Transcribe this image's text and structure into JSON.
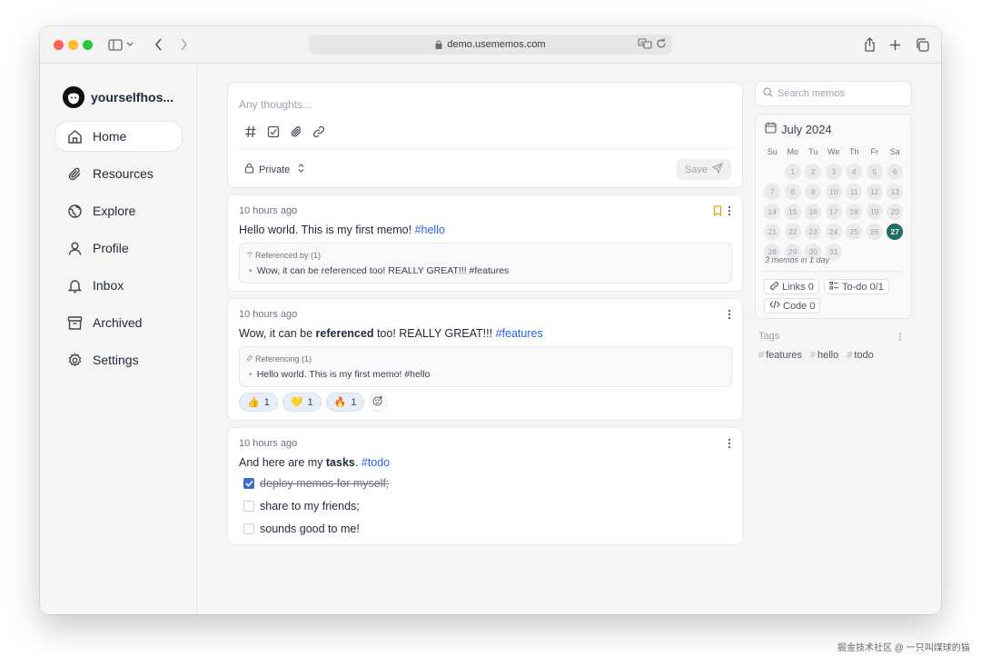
{
  "browser": {
    "url": "demo.usememos.com"
  },
  "sidebar": {
    "user_name": "yourselfhos...",
    "items": [
      {
        "label": "Home",
        "icon": "home-icon",
        "active": true
      },
      {
        "label": "Resources",
        "icon": "paperclip-icon"
      },
      {
        "label": "Explore",
        "icon": "globe-icon"
      },
      {
        "label": "Profile",
        "icon": "user-icon"
      },
      {
        "label": "Inbox",
        "icon": "bell-icon"
      },
      {
        "label": "Archived",
        "icon": "archive-icon"
      },
      {
        "label": "Settings",
        "icon": "gear-icon"
      }
    ]
  },
  "editor": {
    "placeholder": "Any thoughts...",
    "visibility": "Private",
    "save_label": "Save"
  },
  "memos": [
    {
      "time": "10 hours ago",
      "text": "Hello world. This is my first memo! ",
      "tag": "#hello",
      "ref_title": "Referenced by (1)",
      "ref_item": "Wow, it can be referenced too! REALLY GREAT!!! #features"
    },
    {
      "time": "10 hours ago",
      "text_a": "Wow, it can be ",
      "text_bold": "referenced",
      "text_b": " too! REALLY GREAT!!! ",
      "tag": "#features",
      "ref_title": "Referencing (1)",
      "ref_item": "Hello world. This is my first memo! #hello",
      "reactions": [
        {
          "emoji": "👍",
          "count": "1"
        },
        {
          "emoji": "💛",
          "count": "1"
        },
        {
          "emoji": "🔥",
          "count": "1"
        }
      ]
    },
    {
      "time": "10 hours ago",
      "text_a": "And here are my ",
      "text_bold": "tasks",
      "text_b": ". ",
      "tag": "#todo",
      "tasks": [
        {
          "label": "deploy memos for myself;",
          "done": true
        },
        {
          "label": "share to my friends;",
          "done": false
        },
        {
          "label": "sounds good to me!",
          "done": false
        }
      ]
    }
  ],
  "search": {
    "placeholder": "Search memos"
  },
  "calendar": {
    "month": "July 2024",
    "weekdays": [
      "Su",
      "Mo",
      "Tu",
      "We",
      "Th",
      "Fr",
      "Sa"
    ],
    "weeks": [
      [
        "",
        "1",
        "2",
        "3",
        "4",
        "5",
        "6"
      ],
      [
        "7",
        "8",
        "9",
        "10",
        "11",
        "12",
        "13"
      ],
      [
        "14",
        "15",
        "16",
        "17",
        "18",
        "19",
        "20"
      ],
      [
        "21",
        "22",
        "23",
        "24",
        "25",
        "26",
        "27"
      ],
      [
        "28",
        "29",
        "30",
        "31",
        "",
        "",
        ""
      ]
    ],
    "today": "27",
    "summary": "3 memos in 1 day"
  },
  "stats": {
    "links": "Links 0",
    "todo": "To-do 0/1",
    "code": "Code 0"
  },
  "tags": {
    "title": "Tags",
    "items": [
      "features",
      "hello",
      "todo"
    ]
  },
  "watermark": "掘金技术社区 @ 一只叫煤球的猫",
  "colors": {
    "accent": "#1f6f5c",
    "tag": "#2563eb",
    "checkbox": "#3b6cd1",
    "bookmark": "#e0a326"
  }
}
